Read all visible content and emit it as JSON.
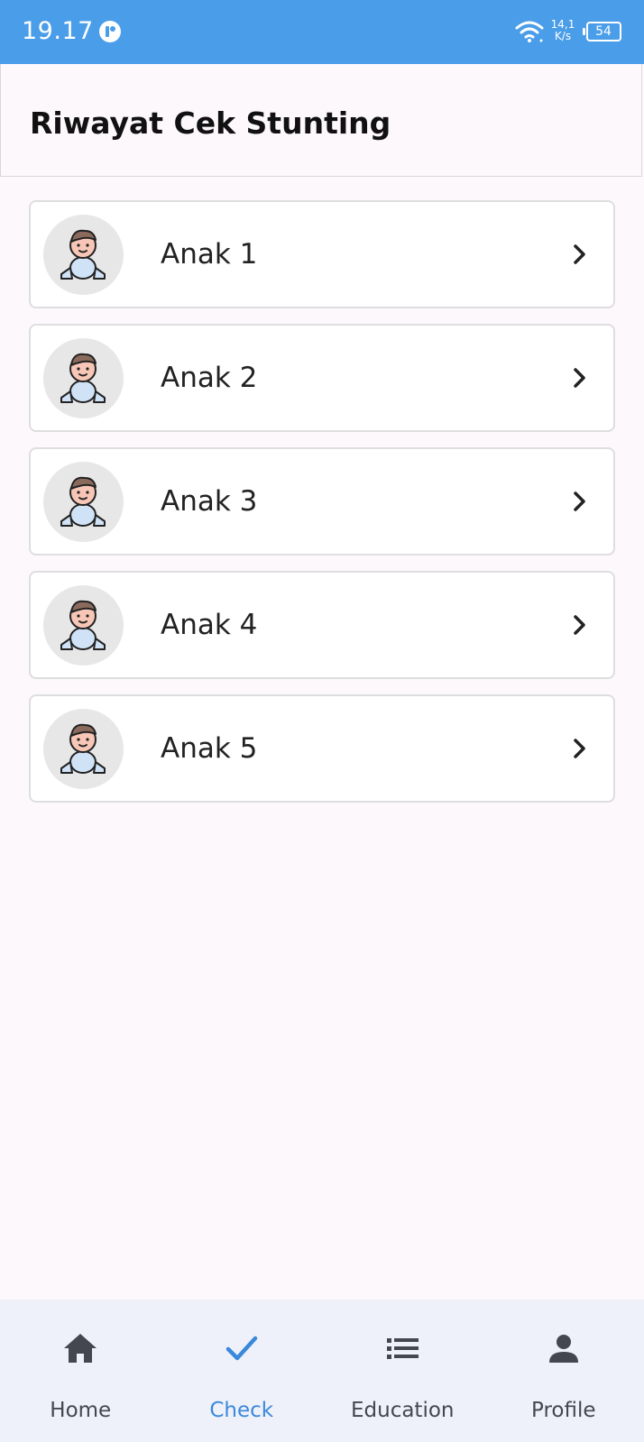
{
  "status_bar": {
    "time": "19.17",
    "net_speed_value": "14,1",
    "net_speed_unit": "K/s",
    "battery": "54",
    "icons": [
      "app-notification-icon",
      "wifi-icon",
      "battery-icon"
    ]
  },
  "header": {
    "title": "Riwayat Cek Stunting"
  },
  "children": [
    {
      "name": "Anak 1",
      "icon": "baby-avatar-icon"
    },
    {
      "name": "Anak 2",
      "icon": "baby-avatar-icon"
    },
    {
      "name": "Anak 3",
      "icon": "baby-avatar-icon"
    },
    {
      "name": "Anak 4",
      "icon": "baby-avatar-icon"
    },
    {
      "name": "Anak 5",
      "icon": "baby-avatar-icon"
    }
  ],
  "bottom_nav": {
    "items": [
      {
        "label": "Home",
        "icon": "home-icon",
        "active": false
      },
      {
        "label": "Check",
        "icon": "check-icon",
        "active": true
      },
      {
        "label": "Education",
        "icon": "list-icon",
        "active": false
      },
      {
        "label": "Profile",
        "icon": "person-icon",
        "active": false
      }
    ]
  },
  "colors": {
    "status_bar": "#4a9de8",
    "background": "#fdf8fc",
    "nav_background": "#eef1f9",
    "active_accent": "#3a88dc",
    "inactive_nav": "#44474f"
  }
}
